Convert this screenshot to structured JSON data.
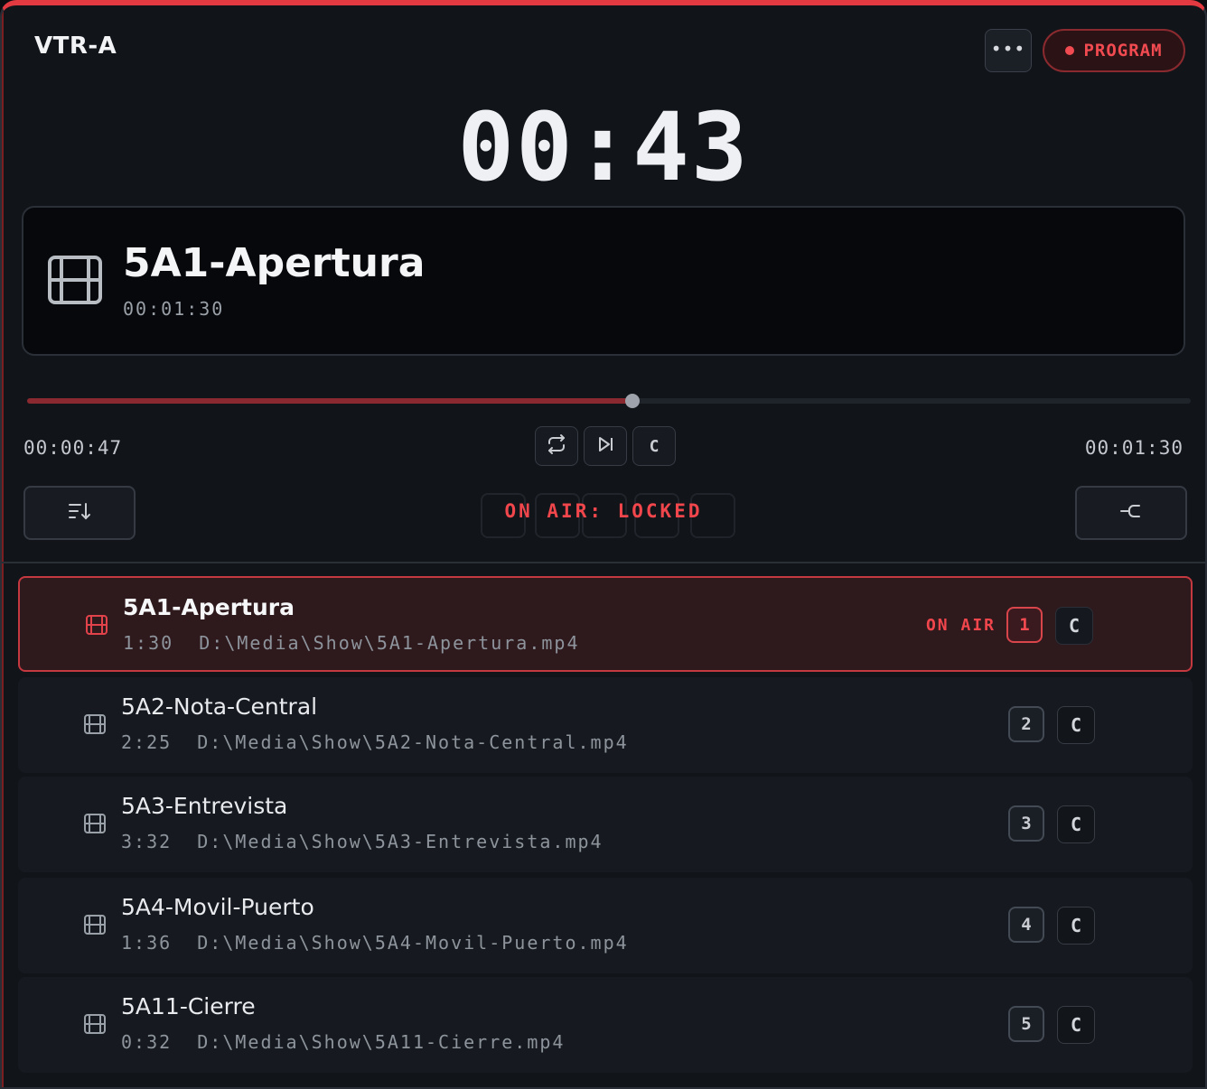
{
  "header": {
    "title": "VTR-A",
    "more_icon": "more-horizontal-icon",
    "program_label": "PROGRAM",
    "accent": "#e23a40"
  },
  "clock": "00:43",
  "current_clip": {
    "icon": "film-icon",
    "name": "5A1-Apertura",
    "duration": "00:01:30"
  },
  "transport": {
    "progress": 0.52,
    "elapsed": "00:00:47",
    "total": "00:01:30",
    "buttons": [
      {
        "icon": "loop-icon",
        "label": ""
      },
      {
        "icon": "skip-next-icon",
        "label": ""
      },
      {
        "icon": "",
        "label": "C"
      }
    ],
    "left_button_icon": "sort-down-icon",
    "right_button_icon": "merge-icon",
    "status": "ON AIR: LOCKED"
  },
  "playlist": [
    {
      "name": "5A1-Apertura",
      "duration": "1:30",
      "path": "D:\\Media\\Show\\5A1-Apertura.mp4",
      "status": "ON AIR",
      "number": "1",
      "cue": "C",
      "active": true
    },
    {
      "name": "5A2-Nota-Central",
      "duration": "2:25",
      "path": "D:\\Media\\Show\\5A2-Nota-Central.mp4",
      "status": "",
      "number": "2",
      "cue": "C",
      "active": false
    },
    {
      "name": "5A3-Entrevista",
      "duration": "3:32",
      "path": "D:\\Media\\Show\\5A3-Entrevista.mp4",
      "status": "",
      "number": "3",
      "cue": "C",
      "active": false
    },
    {
      "name": "5A4-Movil-Puerto",
      "duration": "1:36",
      "path": "D:\\Media\\Show\\5A4-Movil-Puerto.mp4",
      "status": "",
      "number": "4",
      "cue": "C",
      "active": false
    },
    {
      "name": "5A11-Cierre",
      "duration": "0:32",
      "path": "D:\\Media\\Show\\5A11-Cierre.mp4",
      "status": "",
      "number": "5",
      "cue": "C",
      "active": false
    }
  ]
}
